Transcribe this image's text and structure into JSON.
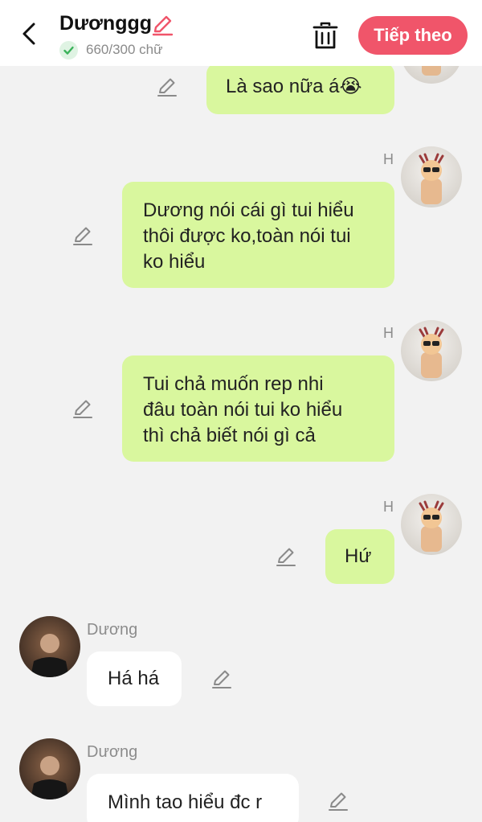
{
  "header": {
    "title": "Dươnggg",
    "char_count": "660/300 chữ",
    "next_label": "Tiếp theo",
    "accent_color": "#f0556a"
  },
  "icons": {
    "back": "chevron-left-icon",
    "edit": "pencil-icon",
    "check": "check-icon",
    "delete": "trash-icon"
  },
  "colors": {
    "outgoing_bubble": "#d9f79e",
    "incoming_bubble": "#ffffff",
    "background": "#f2f2f2"
  },
  "messages": [
    {
      "side": "outgoing",
      "sender": "",
      "lines": [
        "Là sao nữa á😭"
      ]
    },
    {
      "side": "outgoing",
      "sender": "H",
      "lines": [
        "Dương nói cái gì tui hiểu",
        "thôi được ko,toàn nói tui",
        "ko hiểu"
      ]
    },
    {
      "side": "outgoing",
      "sender": "H",
      "lines": [
        "Tui chả muốn rep nhi",
        "đâu toàn nói tui ko hiểu",
        "thì chả biết nói gì cả"
      ]
    },
    {
      "side": "outgoing",
      "sender": "H",
      "lines": [
        "Hứ"
      ]
    },
    {
      "side": "incoming",
      "sender": "Dương",
      "lines": [
        "Há há"
      ]
    },
    {
      "side": "incoming",
      "sender": "Dương",
      "lines": [
        "Mình tao hiểu đc r"
      ]
    }
  ]
}
